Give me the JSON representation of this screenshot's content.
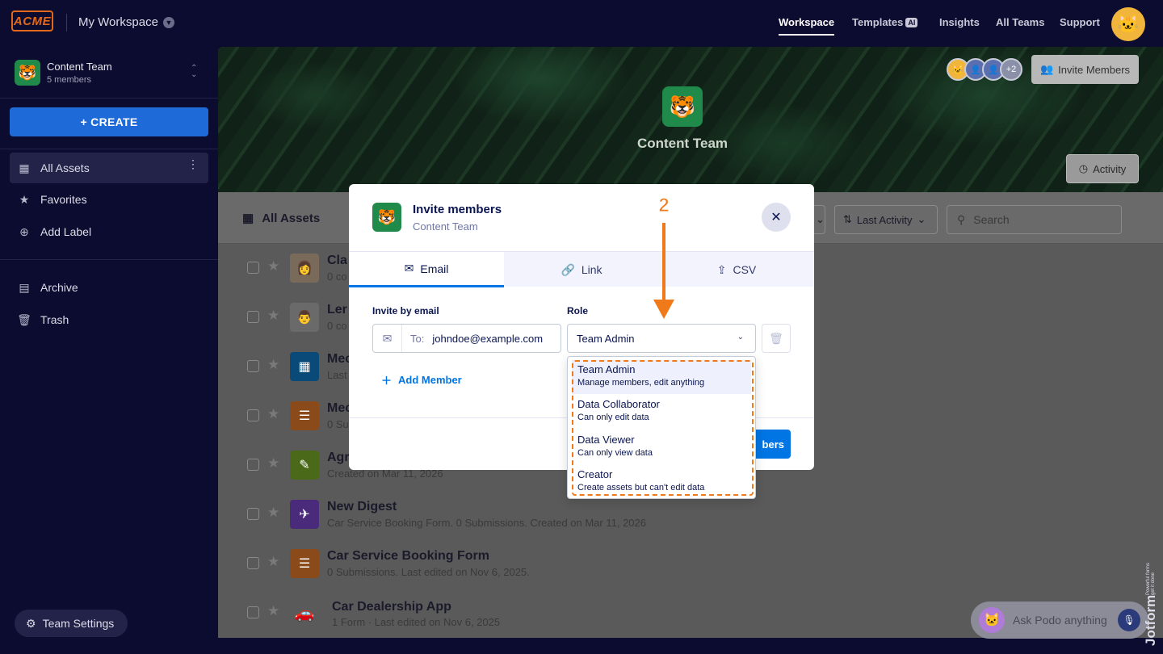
{
  "topbar": {
    "logo": "ACME",
    "workspace": "My Workspace",
    "nav": [
      "Workspace",
      "Templates",
      "Insights",
      "All Teams",
      "Support"
    ],
    "templates_badge": "AI"
  },
  "sidebar": {
    "team_name": "Content Team",
    "team_members": "5 members",
    "create_label": "+ CREATE",
    "items": [
      {
        "label": "All Assets",
        "icon": "grid-icon"
      },
      {
        "label": "Favorites",
        "icon": "star-icon"
      },
      {
        "label": "Add Label",
        "icon": "plus-circle-icon"
      },
      {
        "label": "Archive",
        "icon": "archive-icon"
      },
      {
        "label": "Trash",
        "icon": "trash-icon"
      }
    ],
    "team_settings": "Team Settings"
  },
  "banner": {
    "team_name": "Content Team",
    "more_count": "+2",
    "invite_label": "Invite Members",
    "activity_label": "Activity"
  },
  "toolbar": {
    "title": "All Assets",
    "sort_label": "Last Activity",
    "search_placeholder": "Search"
  },
  "assets": [
    {
      "title": "Cla",
      "sub": "0 co",
      "icon_color": "#888888"
    },
    {
      "title": "Ler",
      "sub": "0 co",
      "icon_color": "#888888"
    },
    {
      "title": "Mec",
      "sub": "Last",
      "icon_color": "#0a75c2"
    },
    {
      "title": "Mec",
      "sub": "0 Su",
      "icon_color": "#e8731b"
    },
    {
      "title": "Agr",
      "sub": "Created on Mar 11, 2026",
      "icon_color": "#78bb07"
    },
    {
      "title": "New Digest",
      "sub": "Car Service Booking Form. 0 Submissions. Created on Mar 11, 2026",
      "icon_color": "#6b3ec4"
    },
    {
      "title": "Car Service Booking Form",
      "sub": "0 Submissions.  Last edited on Nov 6, 2025.",
      "icon_color": "#e8731b"
    },
    {
      "title": "Car Dealership App",
      "sub": "1 Form · Last edited on Nov 6, 2025",
      "icon_color": "#e8731b"
    }
  ],
  "modal": {
    "title": "Invite members",
    "subtitle": "Content Team",
    "tabs": [
      "Email",
      "Link",
      "CSV"
    ],
    "email_label": "Invite by email",
    "role_label": "Role",
    "to_label": "To:",
    "email_value": "johndoe@example.com",
    "role_value": "Team Admin",
    "add_member": "Add Member",
    "send_label": "bers"
  },
  "role_options": [
    {
      "title": "Team Admin",
      "desc": "Manage members, edit anything"
    },
    {
      "title": "Data Collaborator",
      "desc": "Can only edit data"
    },
    {
      "title": "Data Viewer",
      "desc": "Can only view data"
    },
    {
      "title": "Creator",
      "desc": "Create assets but can't edit data"
    }
  ],
  "annotation": {
    "step": "2"
  },
  "podo": {
    "placeholder": "Ask Podo anything"
  },
  "watermark": {
    "brand": "Jotform",
    "tagline": "Powerful forms get it done"
  }
}
